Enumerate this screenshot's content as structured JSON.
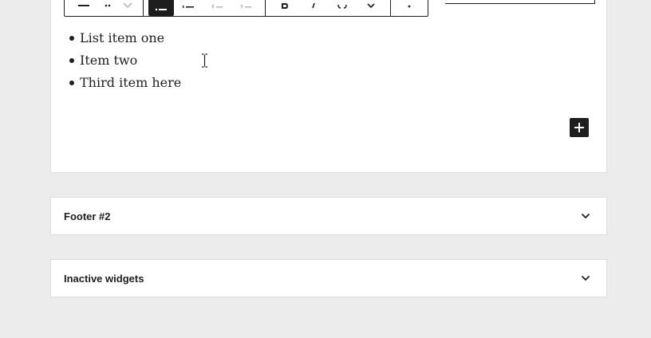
{
  "list_block": {
    "items": [
      "List item one",
      "Item two",
      "Third item here"
    ]
  },
  "widget_areas": [
    {
      "title": "Footer #2"
    },
    {
      "title": "Inactive widgets"
    }
  ],
  "toolbar": {
    "buttons": [
      "align-icon",
      "drag-handle-icon",
      "move-down-icon",
      "unordered-list-icon",
      "ordered-list-icon",
      "outdent-icon",
      "indent-icon",
      "bold-icon",
      "italic-icon",
      "link-icon",
      "more-rich-text-icon",
      "options-icon"
    ]
  },
  "colors": {
    "background": "#ececec",
    "panel": "#ffffff",
    "border": "#dcdcde",
    "dark": "#1e1e1e"
  }
}
